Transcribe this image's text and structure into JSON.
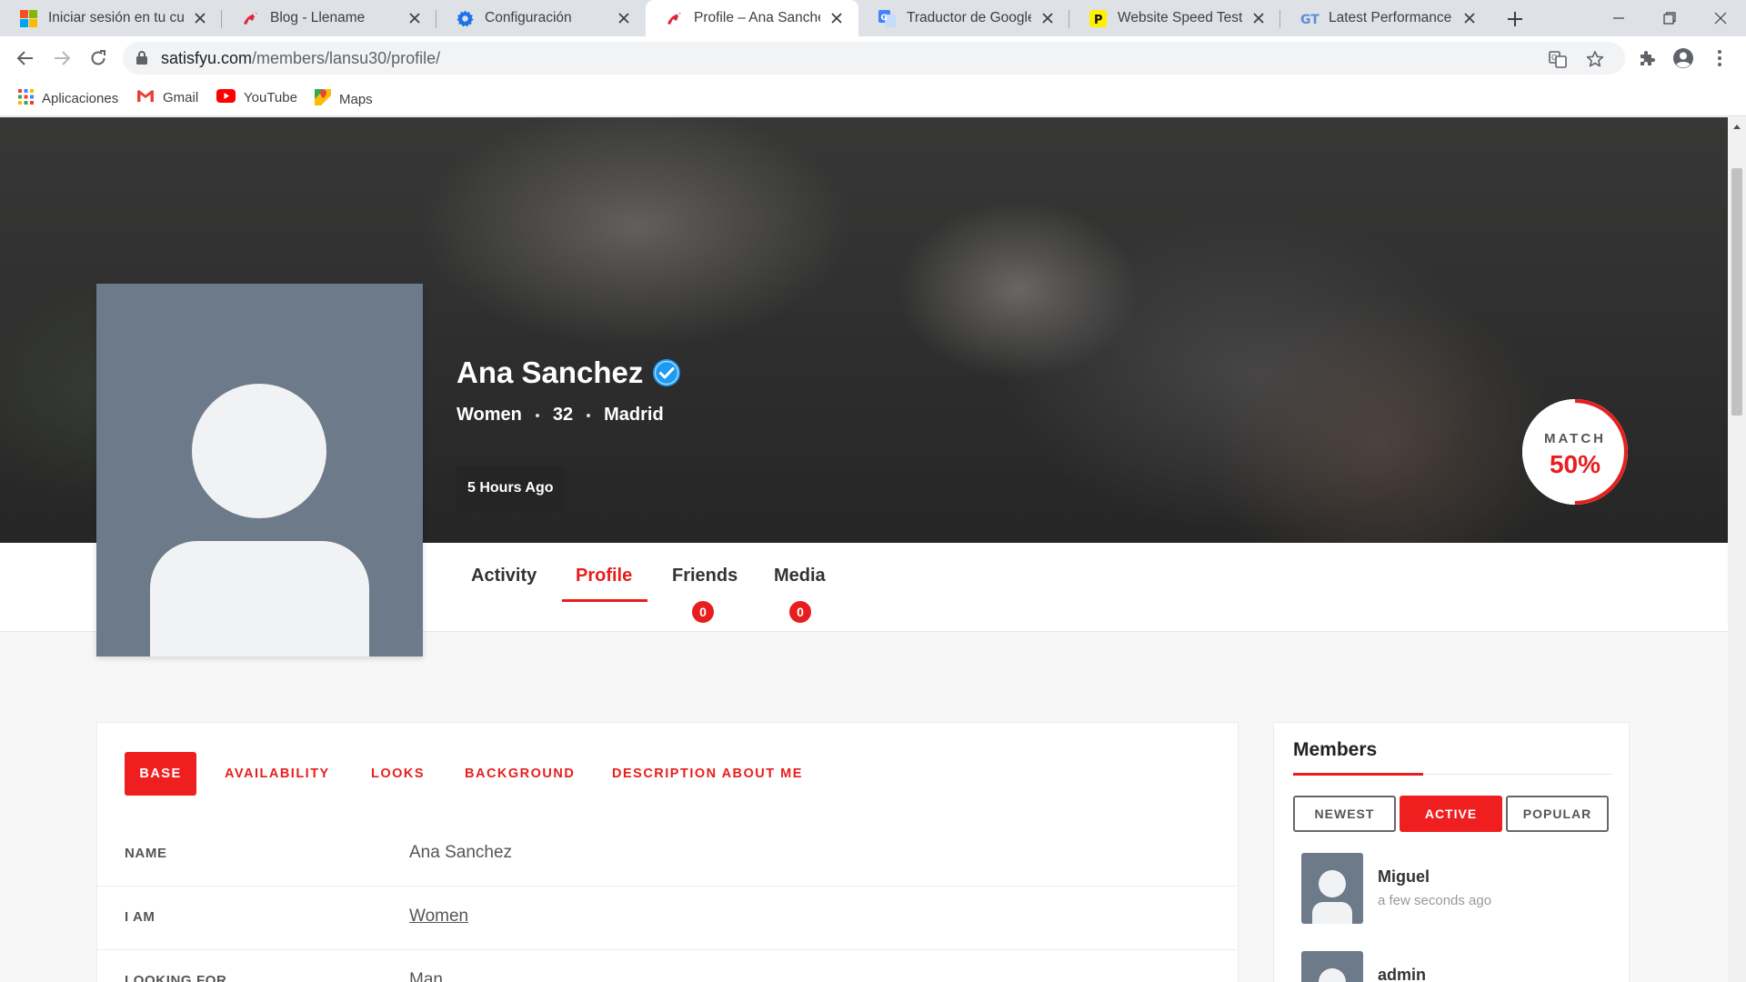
{
  "browser": {
    "tabs": [
      {
        "title": "Iniciar sesión en tu cuenta",
        "favicon": "microsoft-icon"
      },
      {
        "title": "Blog - Llename",
        "favicon": "bird-icon"
      },
      {
        "title": "Configuración",
        "favicon": "gear-icon"
      },
      {
        "title": "Profile – Ana Sanchez – Satisfyu",
        "favicon": "bird-icon",
        "active": true
      },
      {
        "title": "Traductor de Google",
        "favicon": "google-translate-icon"
      },
      {
        "title": "Website Speed Test | Pingdom Tools",
        "favicon": "pingdom-icon"
      },
      {
        "title": "Latest Performance Report",
        "favicon": "gtmetrix-icon"
      }
    ],
    "url_domain": "satisfyu.com",
    "url_path": "/members/lansu30/profile/",
    "bookmarks": [
      {
        "label": "Aplicaciones",
        "icon": "apps-grid-icon"
      },
      {
        "label": "Gmail",
        "icon": "gmail-icon"
      },
      {
        "label": "YouTube",
        "icon": "youtube-icon"
      },
      {
        "label": "Maps",
        "icon": "maps-icon"
      }
    ]
  },
  "profile": {
    "name": "Ana Sanchez",
    "gender": "Women",
    "age": "32",
    "city": "Madrid",
    "last_active": "5 Hours Ago",
    "match_label": "MATCH",
    "match_value": "50%",
    "match_fraction": 0.5
  },
  "profile_tabs": [
    {
      "label": "Activity"
    },
    {
      "label": "Profile",
      "active": true
    },
    {
      "label": "Friends",
      "badge": "0"
    },
    {
      "label": "Media",
      "badge": "0"
    }
  ],
  "sub_tabs": [
    "BASE",
    "AVAILABILITY",
    "LOOKS",
    "BACKGROUND",
    "DESCRIPTION ABOUT ME"
  ],
  "fields": [
    {
      "label": "NAME",
      "value": "Ana Sanchez"
    },
    {
      "label": "I AM",
      "value": "Women"
    },
    {
      "label": "LOOKING FOR",
      "value": "Man"
    }
  ],
  "members": {
    "title": "Members",
    "filters": [
      "NEWEST",
      "ACTIVE",
      "POPULAR"
    ],
    "active_filter": "ACTIVE",
    "list": [
      {
        "name": "Miguel",
        "time": "a few seconds ago"
      },
      {
        "name": "admin",
        "time": ""
      }
    ]
  },
  "colors": {
    "accent": "#e81e1e",
    "verified": "#1d9bf0",
    "avatar_bg": "#6c7a89"
  }
}
